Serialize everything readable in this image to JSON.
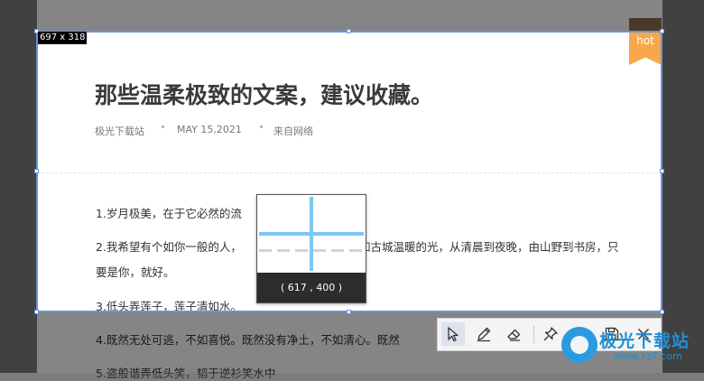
{
  "article": {
    "title": "那些温柔极致的文案，建议收藏。",
    "meta": {
      "site": "极光下载站",
      "date": "MAY 15,2021",
      "source": "来自网络"
    },
    "paragraphs": [
      {
        "text": "1.岁月极美，在于它必然的流"
      },
      {
        "text": "2.我希望有个如你一般的人，"
      },
      {
        "text": "如古城温暖的光，从清晨到夜晚，由山野到书房，只"
      },
      {
        "text": "要是你，就好。"
      },
      {
        "text": "3.低头弄莲子，莲子清如水。"
      },
      {
        "text": "4.既然无处可逃，不如喜悦。既然没有净土，不如清心。既然"
      },
      {
        "text": "5.盗般谐弄低头笑，韬于逆衫笑水中"
      }
    ],
    "hot_badge": "hot"
  },
  "capture": {
    "size_label": "697 x 318",
    "magnifier_coords": "( 617 , 400 )"
  },
  "toolbar": {
    "tools": [
      {
        "name": "select-arrow-icon",
        "active": true
      },
      {
        "name": "pen-icon",
        "active": false
      },
      {
        "name": "eraser-icon",
        "active": false
      },
      {
        "name": "pin-icon",
        "active": false
      },
      {
        "name": "copy-icon",
        "active": false
      },
      {
        "name": "save-icon",
        "active": false
      },
      {
        "name": "close-icon",
        "active": false
      }
    ]
  },
  "watermark": {
    "title": "极光下载站",
    "url": "www.xz7.com"
  },
  "colors": {
    "selection_border": "#6a95d8",
    "crosshair": "#7cc7f4",
    "hot_badge": "#f6a84a",
    "watermark": "#1e8fd6"
  }
}
